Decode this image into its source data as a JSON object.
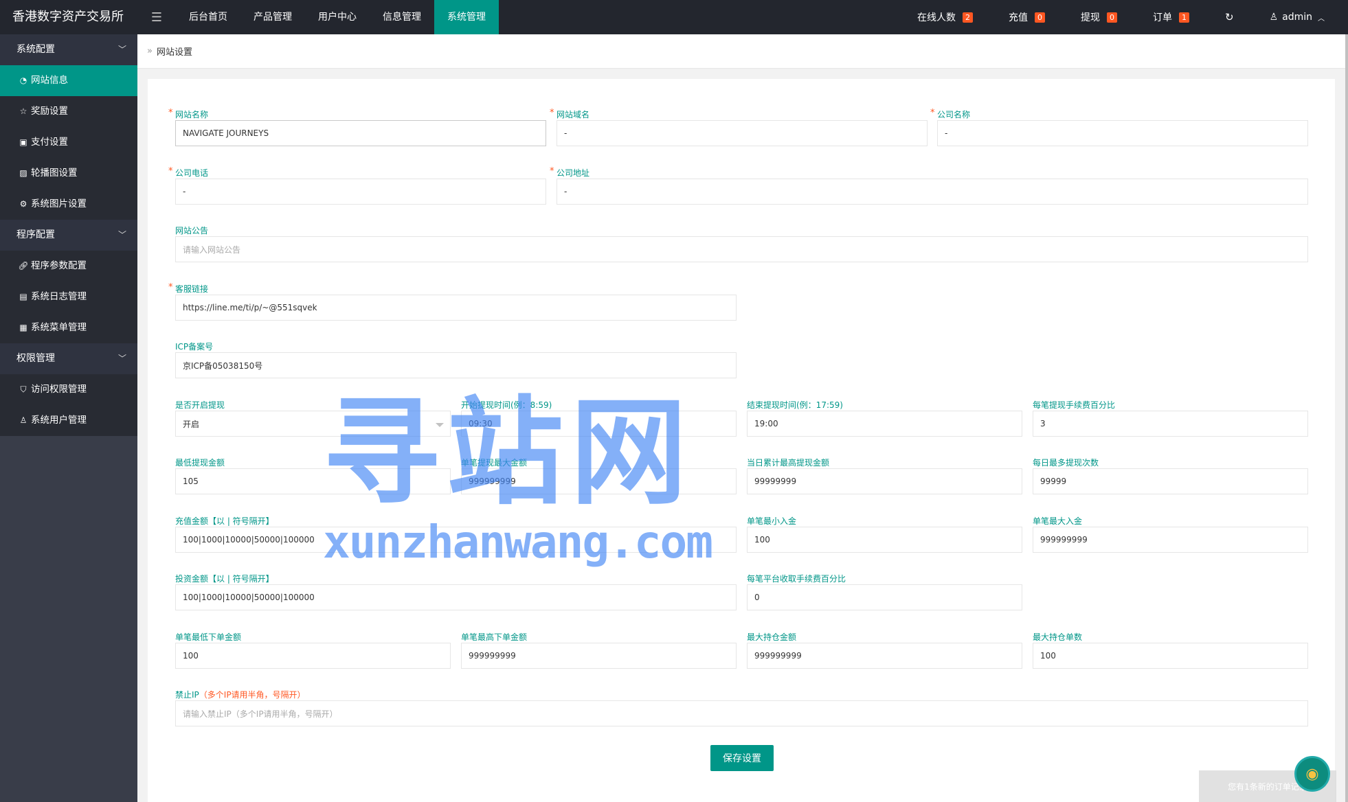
{
  "header": {
    "logo": "香港数字资产交易所",
    "nav": [
      "后台首页",
      "产品管理",
      "用户中心",
      "信息管理",
      "系统管理"
    ],
    "active_nav": 4,
    "right": {
      "online_label": "在线人数",
      "online_count": "2",
      "recharge_label": "充值",
      "recharge_count": "0",
      "withdraw_label": "提现",
      "withdraw_count": "0",
      "order_label": "订单",
      "order_count": "1",
      "user": "admin"
    }
  },
  "sidebar": {
    "groups": [
      {
        "label": "系统配置",
        "items": [
          "网站信息",
          "奖励设置",
          "支付设置",
          "轮播图设置",
          "系统图片设置"
        ]
      },
      {
        "label": "程序配置",
        "items": [
          "程序参数配置",
          "系统日志管理",
          "系统菜单管理"
        ]
      },
      {
        "label": "权限管理",
        "items": [
          "访问权限管理",
          "系统用户管理"
        ]
      }
    ]
  },
  "breadcrumb": "网站设置",
  "form": {
    "site_name": {
      "label": "网站名称",
      "value": "NAVIGATE JOURNEYS"
    },
    "site_domain": {
      "label": "网站域名",
      "value": "-"
    },
    "company_name": {
      "label": "公司名称",
      "value": "-"
    },
    "company_phone": {
      "label": "公司电话",
      "value": "-"
    },
    "company_address": {
      "label": "公司地址",
      "value": "-"
    },
    "site_notice": {
      "label": "网站公告",
      "placeholder": "请输入网站公告"
    },
    "service_link": {
      "label": "客服链接",
      "value": "https://line.me/ti/p/~@551sqvek"
    },
    "icp": {
      "label": "ICP备案号",
      "value": "京ICP备05038150号"
    },
    "withdraw_enabled": {
      "label": "是否开启提现",
      "value": "开启"
    },
    "withdraw_start": {
      "label": "开始提现时间(例：8:59)",
      "value": "09:30"
    },
    "withdraw_end": {
      "label": "结束提现时间(例：17:59)",
      "value": "19:00"
    },
    "withdraw_fee": {
      "label": "每笔提现手续费百分比",
      "value": "3"
    },
    "min_withdraw": {
      "label": "最低提现金额",
      "value": "105"
    },
    "max_single_withdraw": {
      "label": "单笔提现最大金额",
      "value": "999999999"
    },
    "daily_max_withdraw": {
      "label": "当日累计最高提现金额",
      "value": "99999999"
    },
    "daily_withdraw_times": {
      "label": "每日最多提现次数",
      "value": "99999"
    },
    "recharge_amounts": {
      "label": "充值金额【以 | 符号隔开】",
      "value": "100|1000|10000|50000|100000"
    },
    "min_deposit": {
      "label": "单笔最小入金",
      "value": "100"
    },
    "max_deposit": {
      "label": "单笔最大入金",
      "value": "999999999"
    },
    "invest_amounts": {
      "label": "投资金额【以 | 符号隔开】",
      "value": "100|1000|10000|50000|100000"
    },
    "platform_fee": {
      "label": "每笔平台收取手续费百分比",
      "value": "0"
    },
    "min_order": {
      "label": "单笔最低下单金额",
      "value": "100"
    },
    "max_order": {
      "label": "单笔最高下单金额",
      "value": "999999999"
    },
    "max_hold_amount": {
      "label": "最大持仓金额",
      "value": "999999999"
    },
    "max_hold_count": {
      "label": "最大持仓单数",
      "value": "100"
    },
    "ban_ip": {
      "label": "禁止IP",
      "hint": "（多个IP请用半角，号隔开）",
      "placeholder": "请输入禁止IP（多个IP请用半角，号隔开）"
    },
    "save_label": "保存设置"
  },
  "watermark": {
    "cn": "寻站网",
    "en": "xunzhanwang.com"
  },
  "notice": "您有1条新的订单记录",
  "colors": {
    "accent": "#009688",
    "header": "#23262e",
    "sidebar": "#393d49",
    "badge": "#ff5722"
  }
}
